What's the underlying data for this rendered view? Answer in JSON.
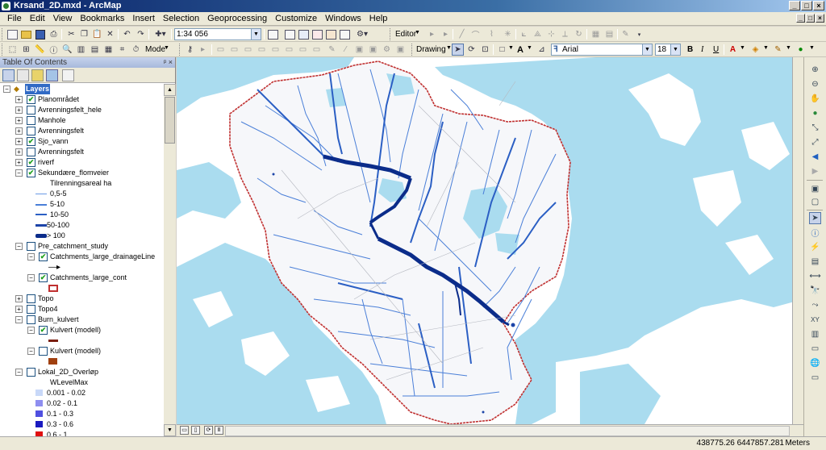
{
  "window": {
    "title": "Krsand_2D.mxd - ArcMap"
  },
  "menu": [
    "File",
    "Edit",
    "View",
    "Bookmarks",
    "Insert",
    "Selection",
    "Geoprocessing",
    "Customize",
    "Windows",
    "Help"
  ],
  "toolbar": {
    "scale": "1:34 056",
    "editor_label": "Editor",
    "mode_label": "Mode",
    "drawing_label": "Drawing",
    "font_name": "Arial",
    "font_size": "18",
    "bold_label": "B",
    "italic_label": "I",
    "underline_label": "U",
    "text_tool_label": "A"
  },
  "toc": {
    "title": "Table Of Contents",
    "root": "Layers",
    "layers": [
      {
        "label": "Planområdet",
        "checked": true,
        "expanded": false
      },
      {
        "label": "Avrenningsfelt_hele",
        "checked": false,
        "expanded": false
      },
      {
        "label": "Manhole",
        "checked": false,
        "expanded": false
      },
      {
        "label": "Avrenningsfelt",
        "checked": false,
        "expanded": false
      },
      {
        "label": "Sjo_vann",
        "checked": true,
        "expanded": false
      },
      {
        "label": "Avrenningsfelt",
        "checked": false,
        "expanded": false
      },
      {
        "label": "riverf",
        "checked": true,
        "expanded": false
      },
      {
        "label": "Sekundære_flomveier",
        "checked": true,
        "expanded": true
      }
    ],
    "flomveier_field": "Tilrenningsareal ha",
    "flomveier_classes": [
      "0,5-5",
      "5-10",
      "10-50",
      "50-100",
      "> 100"
    ],
    "pre_catchment": "Pre_catchment_study",
    "drainage_line": "Catchments_large_drainageLine",
    "catchments_cont": "Catchments_large_cont",
    "topo": "Topo",
    "topo4": "Topo4",
    "burn_kulvert": "Burn_kulvert",
    "kulvert_1": "Kulvert (modell)",
    "kulvert_2": "Kulvert (modell)",
    "lokal_2d": "Lokal_2D_Overløp",
    "wlevel_field": "WLevelMax",
    "wlevel_classes": [
      "0.001 - 0.02",
      "0.02 - 0.1",
      "0.1 - 0.3",
      "0.3 - 0.6",
      "0.6 - 1"
    ],
    "wlevel_colors": [
      "#c8d8f8",
      "#8e8ef0",
      "#5050e0",
      "#1a1ac0",
      "#e01010"
    ]
  },
  "status": {
    "coordinates": "438775.26  6447857.281",
    "units": "Meters"
  },
  "colors": {
    "water": "#aadcef",
    "flow_light": "#4a7fd8",
    "flow_dark": "#0b2c8a",
    "boundary": "#c03030"
  }
}
